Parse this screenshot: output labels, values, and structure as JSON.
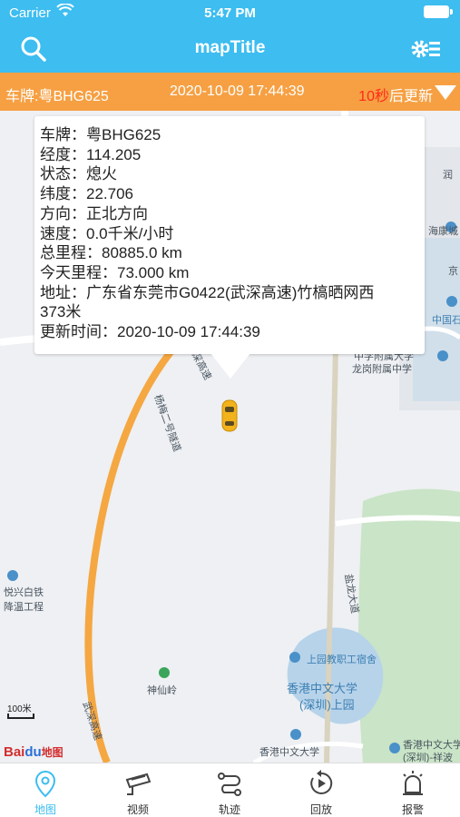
{
  "status_bar": {
    "carrier": "Carrier",
    "time": "5:47 PM"
  },
  "nav": {
    "title": "mapTitle",
    "left_icon": "search-icon",
    "right_icon": "settings-list-icon"
  },
  "info_bar": {
    "plate": "车牌:粤BHG625",
    "update_time": "2020-10-09 17:44:39",
    "countdown_seconds": "10秒",
    "countdown_suffix": "后更新"
  },
  "popup": {
    "rows": [
      "车牌：粤BHG625",
      "经度：114.205",
      "状态：熄火",
      "纬度：22.706",
      "方向：正北方向",
      "速度：0.0千米/小时",
      "总里程：80885.0 km",
      "今天里程：73.000 km",
      "地址：广东省东莞市G0422(武深高速)竹槁晒网西",
      "373米",
      "更新时间：2020-10-09 17:44:39"
    ]
  },
  "map": {
    "labels": {
      "highway_top": "武深高速",
      "yangmei": "杨梅二号隧道",
      "highway_bottom": "武深高速",
      "shenxianling": "神仙岭",
      "yuexing": "悦兴白铁",
      "jiangwen": "降温工程",
      "yanlong": "盐龙大道",
      "shangyuan": "上园教职工宿舍",
      "cuhk_a": "香港中文大学",
      "cuhk_b": "(深圳)上园",
      "cuhk_c": "香港中文大学",
      "cuhk_d": "香港中文大学",
      "cuhk_e": "(深圳)-祥波",
      "school_a": "中学附属大学",
      "school_b": "龙岗附属中学",
      "top_right_a": "润",
      "top_right_b": "海康城",
      "top_right_c": "京",
      "top_right_d": "中国石"
    },
    "scale": "100米",
    "brand_a": "Bai",
    "brand_paw": "du",
    "brand_b": "地图"
  },
  "tabs": [
    {
      "label": "地图",
      "icon": "map-pin-icon",
      "active": true
    },
    {
      "label": "视频",
      "icon": "camera-icon",
      "active": false
    },
    {
      "label": "轨迹",
      "icon": "route-icon",
      "active": false
    },
    {
      "label": "回放",
      "icon": "replay-icon",
      "active": false
    },
    {
      "label": "报警",
      "icon": "alarm-icon",
      "active": false
    }
  ],
  "colors": {
    "header": "#3dbdf0",
    "info_bar": "#f6a043",
    "countdown": "#ff2a1a",
    "road": "#f5a742",
    "park": "#c9e4c6",
    "water": "#b7d3ea"
  }
}
